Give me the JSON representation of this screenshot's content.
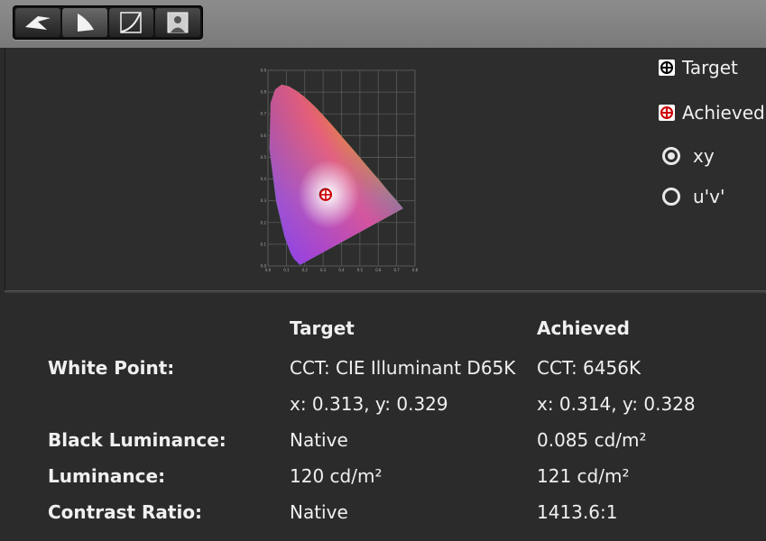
{
  "toolbar": {
    "buttons": [
      {
        "icon": "display-icon",
        "active": false
      },
      {
        "icon": "gamut-icon",
        "active": true
      },
      {
        "icon": "curve-icon",
        "active": false
      },
      {
        "icon": "portrait-icon",
        "active": false
      }
    ]
  },
  "legend": {
    "target_label": "Target",
    "achieved_label": "Achieved"
  },
  "mode": {
    "options": [
      "xy",
      "u'v'"
    ],
    "selected": "xy"
  },
  "table": {
    "col_target": "Target",
    "col_achieved": "Achieved",
    "rows": [
      {
        "label": "White Point:",
        "target": "CCT: CIE Illuminant D65K",
        "achieved": "CCT: 6456K"
      },
      {
        "label": "",
        "target": "x: 0.313, y: 0.329",
        "achieved": "x: 0.314, y: 0.328"
      },
      {
        "label": "Black Luminance:",
        "target": "Native",
        "achieved": "0.085 cd/m²"
      },
      {
        "label": "Luminance:",
        "target": "120 cd/m²",
        "achieved": "121 cd/m²"
      },
      {
        "label": "Contrast Ratio:",
        "target": "Native",
        "achieved": "1413.6:1"
      }
    ]
  },
  "chart_data": {
    "type": "scatter",
    "xlim": [
      0,
      0.8
    ],
    "ylim": [
      0,
      0.9
    ],
    "x_ticks": [
      "0.0",
      "0.1",
      "0.2",
      "0.3",
      "0.4",
      "0.5",
      "0.6",
      "0.7",
      "0.8"
    ],
    "y_ticks": [
      "0.0",
      "0.1",
      "0.2",
      "0.3",
      "0.4",
      "0.5",
      "0.6",
      "0.7",
      "0.8",
      "0.9"
    ],
    "grid": true,
    "series": [
      {
        "name": "Target",
        "x": [
          0.313
        ],
        "y": [
          0.329
        ]
      },
      {
        "name": "Achieved",
        "x": [
          0.314
        ],
        "y": [
          0.328
        ]
      }
    ],
    "colors": {
      "target": "#000000",
      "achieved": "#cc0000"
    }
  }
}
